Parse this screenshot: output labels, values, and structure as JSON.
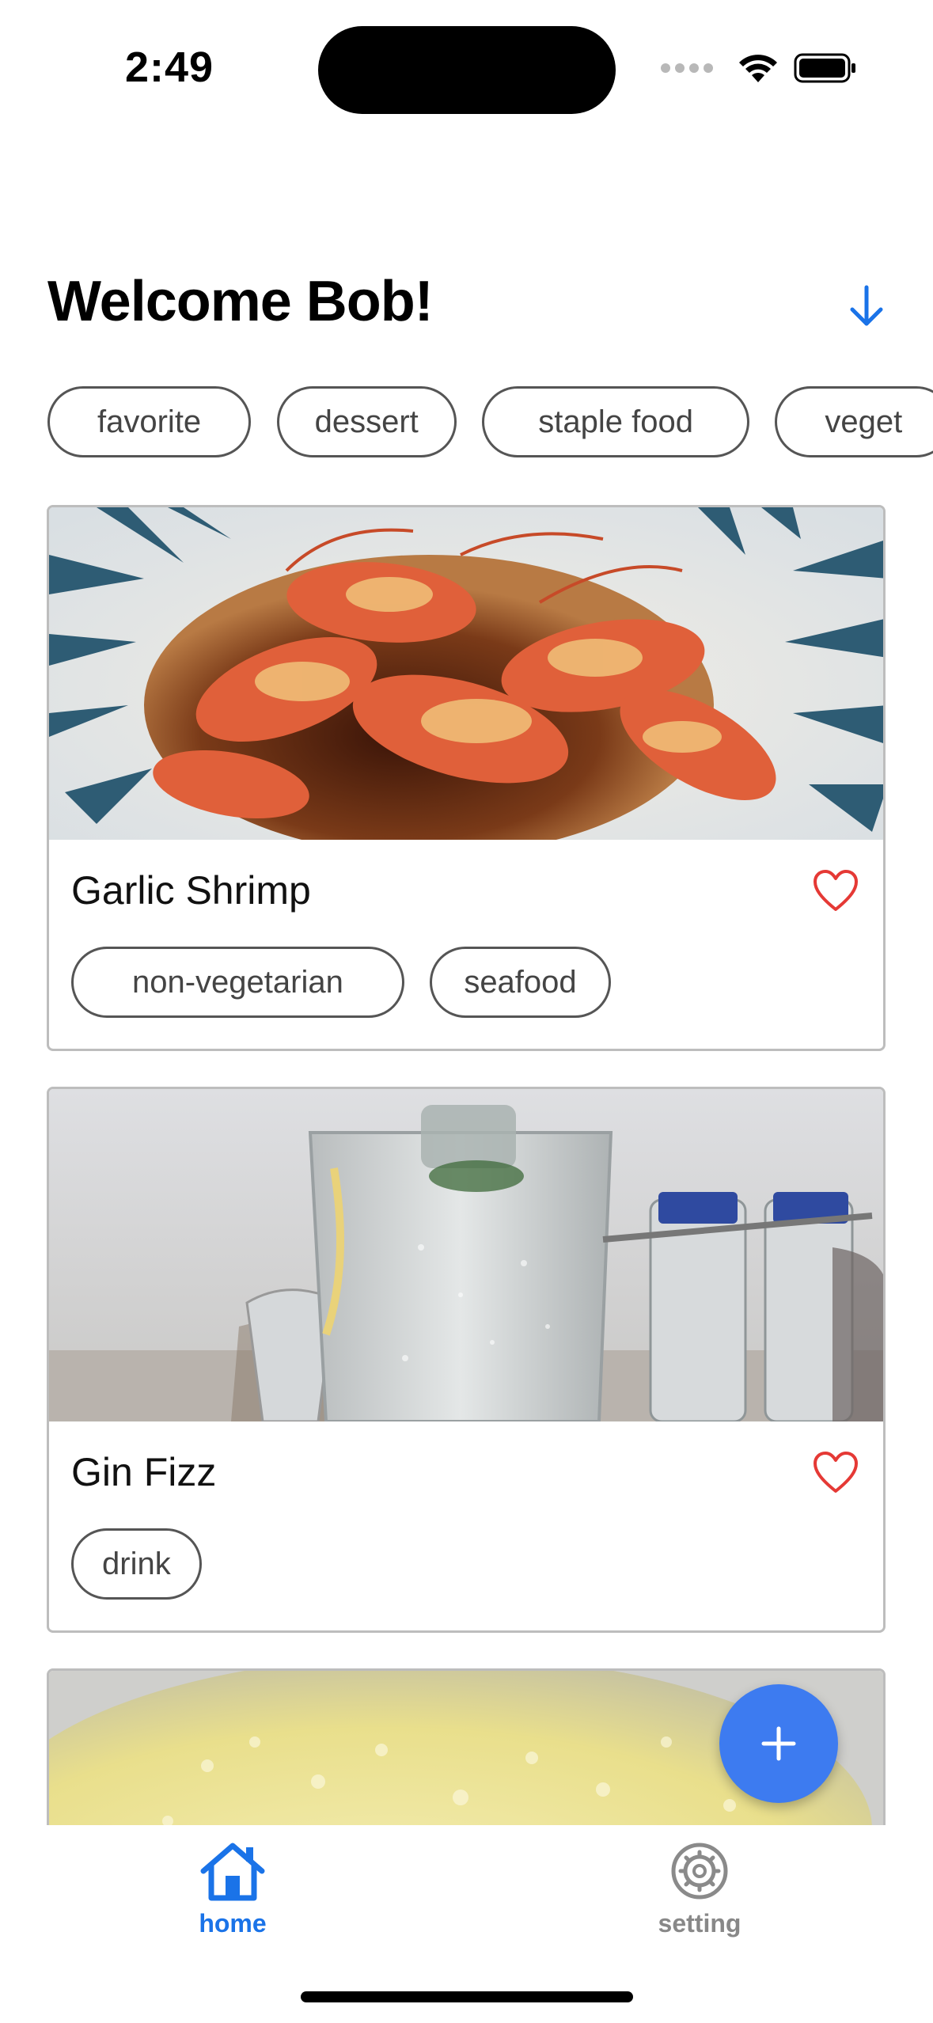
{
  "status_bar": {
    "time": "2:49"
  },
  "header": {
    "title": "Welcome Bob!",
    "sort_icon": "arrow-down-icon"
  },
  "filters": [
    "favorite",
    "dessert",
    "staple food",
    "veget"
  ],
  "recipes": [
    {
      "title": "Garlic Shrimp",
      "favorite": true,
      "tags": [
        "non-vegetarian",
        "seafood"
      ]
    },
    {
      "title": "Gin Fizz",
      "favorite": true,
      "tags": [
        "drink"
      ]
    }
  ],
  "fab": {
    "icon": "plus-icon"
  },
  "tab_bar": {
    "home_label": "home",
    "setting_label": "setting"
  },
  "colors": {
    "accent": "#1a73e8",
    "fab": "#3d7bf0",
    "heart": "#e53935"
  }
}
